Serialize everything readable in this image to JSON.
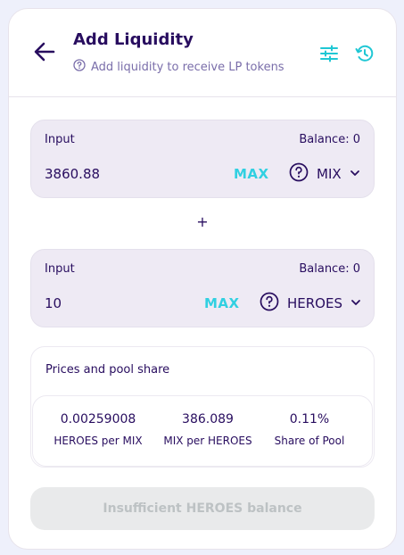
{
  "header": {
    "title": "Add Liquidity",
    "subtitle": "Add liquidity to receive LP tokens",
    "icons": [
      "back-arrow-icon",
      "help-icon",
      "settings-sliders-icon",
      "history-icon"
    ]
  },
  "input_a": {
    "label": "Input",
    "balance": "Balance: 0",
    "amount": "3860.88",
    "max_label": "MAX",
    "token": "MIX"
  },
  "plus": "+",
  "input_b": {
    "label": "Input",
    "balance": "Balance: 0",
    "amount": "10",
    "max_label": "MAX",
    "token": "HEROES"
  },
  "prices": {
    "title": "Prices and pool share",
    "stats": [
      {
        "value": "0.00259008",
        "label": "HEROES per MIX"
      },
      {
        "value": "386.089",
        "label": "MIX per HEROES"
      },
      {
        "value": "0.11%",
        "label": "Share of Pool"
      }
    ]
  },
  "submit_label": "Insufficient HEROES balance",
  "colors": {
    "text": "#280d5f",
    "secondary": "#7a6eaa",
    "accent": "#31d0e1",
    "panel": "#eeeaf4",
    "disabled": "#e9eaeb",
    "disabled_text": "#bdc2c4"
  }
}
